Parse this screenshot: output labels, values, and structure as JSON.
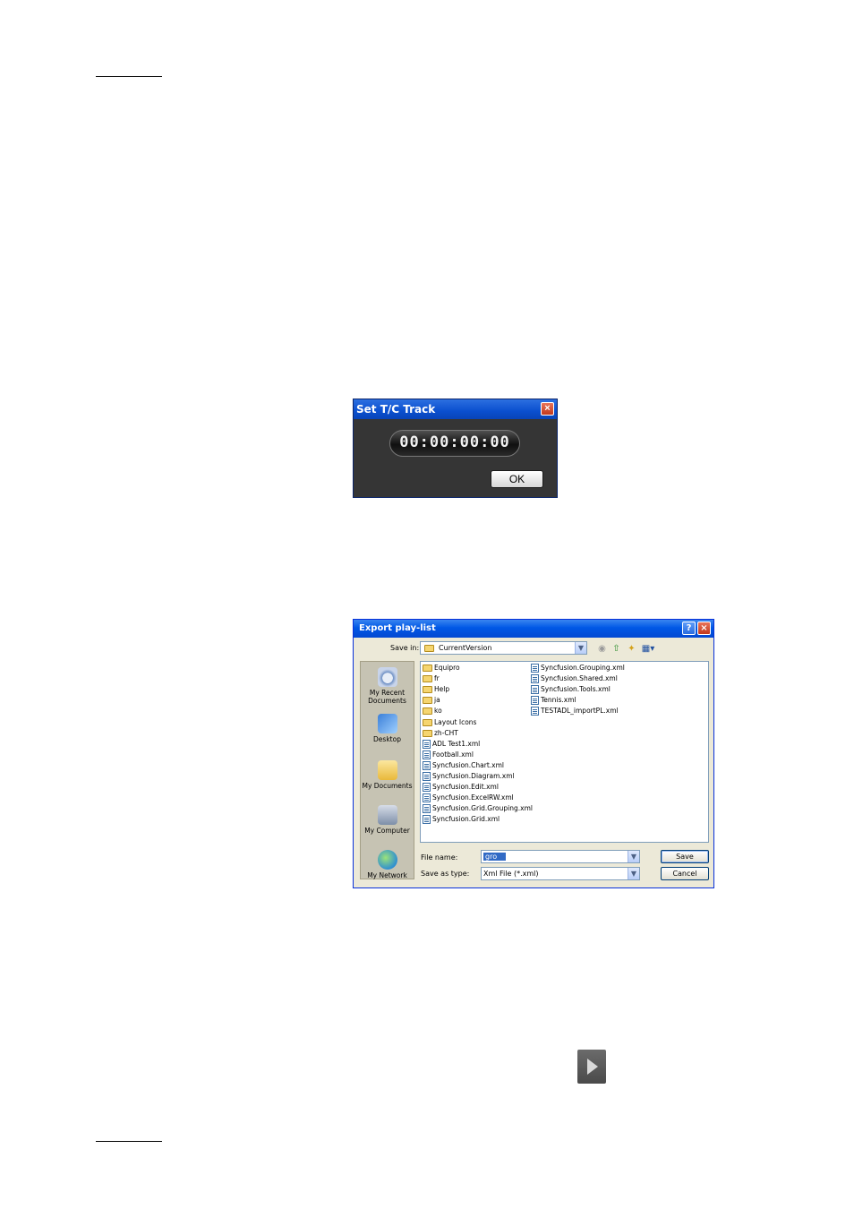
{
  "tc_dialog": {
    "title": "Set T/C Track",
    "close_glyph": "×",
    "timecode": "00:00:00:00",
    "ok_label": "OK"
  },
  "export_dialog": {
    "title": "Export play-list",
    "help_glyph": "?",
    "close_glyph": "×",
    "save_in_label": "Save in:",
    "save_in_value": "CurrentVersion",
    "places": [
      {
        "label": "My Recent Documents",
        "icon": "recent-documents-icon"
      },
      {
        "label": "Desktop",
        "icon": "desktop-icon"
      },
      {
        "label": "My Documents",
        "icon": "my-documents-icon"
      },
      {
        "label": "My Computer",
        "icon": "my-computer-icon"
      },
      {
        "label": "My Network",
        "icon": "my-network-icon"
      }
    ],
    "files_col1": [
      {
        "name": "Equipro",
        "type": "folder"
      },
      {
        "name": "fr",
        "type": "folder"
      },
      {
        "name": "Help",
        "type": "folder"
      },
      {
        "name": "ja",
        "type": "folder"
      },
      {
        "name": "ko",
        "type": "folder"
      },
      {
        "name": "Layout Icons",
        "type": "folder"
      },
      {
        "name": "zh-CHT",
        "type": "folder"
      },
      {
        "name": "ADL Test1.xml",
        "type": "xml"
      },
      {
        "name": "Football.xml",
        "type": "xml"
      },
      {
        "name": "Syncfusion.Chart.xml",
        "type": "xml"
      },
      {
        "name": "Syncfusion.Diagram.xml",
        "type": "xml"
      },
      {
        "name": "Syncfusion.Edit.xml",
        "type": "xml"
      },
      {
        "name": "Syncfusion.ExcelRW.xml",
        "type": "xml"
      },
      {
        "name": "Syncfusion.Grid.Grouping.xml",
        "type": "xml"
      },
      {
        "name": "Syncfusion.Grid.xml",
        "type": "xml"
      }
    ],
    "files_col2": [
      {
        "name": "Syncfusion.Grouping.xml",
        "type": "xml"
      },
      {
        "name": "Syncfusion.Shared.xml",
        "type": "xml"
      },
      {
        "name": "Syncfusion.Tools.xml",
        "type": "xml"
      },
      {
        "name": "Tennis.xml",
        "type": "xml"
      },
      {
        "name": "TESTADL_importPL.xml",
        "type": "xml"
      }
    ],
    "file_name_label": "File name:",
    "file_name_value": "gro",
    "save_as_type_label": "Save as type:",
    "save_as_type_value": "Xml File (*.xml)",
    "save_label": "Save",
    "cancel_label": "Cancel"
  },
  "play_icon": {
    "icon": "play-arrow-icon"
  }
}
